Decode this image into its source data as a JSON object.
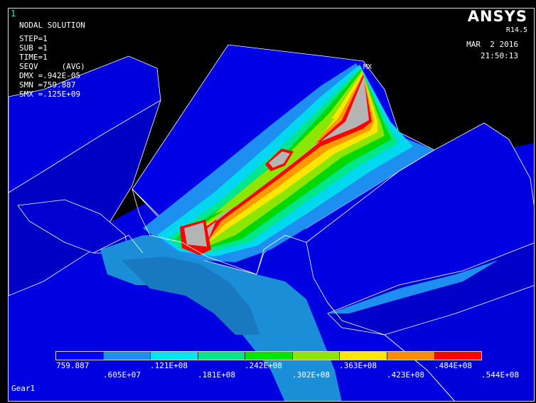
{
  "window_number": "1",
  "brand": "ANSYS",
  "version": "R14.5",
  "date": "MAR  2 2016",
  "time": "21:50:13",
  "solution": {
    "title": "NODAL SOLUTION",
    "lines": [
      "STEP=1",
      "SUB =1",
      "TIME=1",
      "SEQV     (AVG)",
      "DMX =.942E-05",
      "SMN =759.887",
      "SMX =.125E+09"
    ]
  },
  "max_marker": "MX",
  "legend": {
    "colors": [
      "#0000ff",
      "#1d8ff0",
      "#00e6f0",
      "#00e68c",
      "#00e600",
      "#8ce600",
      "#ffe600",
      "#ff8c00",
      "#ff0000"
    ],
    "labels_top": [
      "759.887",
      ".121E+08",
      ".242E+08",
      ".363E+08",
      ".484E+08"
    ],
    "labels_bottom": [
      ".605E+07",
      ".181E+08",
      ".302E+08",
      ".423E+08",
      ".544E+08"
    ]
  },
  "model_name": "Gear1"
}
